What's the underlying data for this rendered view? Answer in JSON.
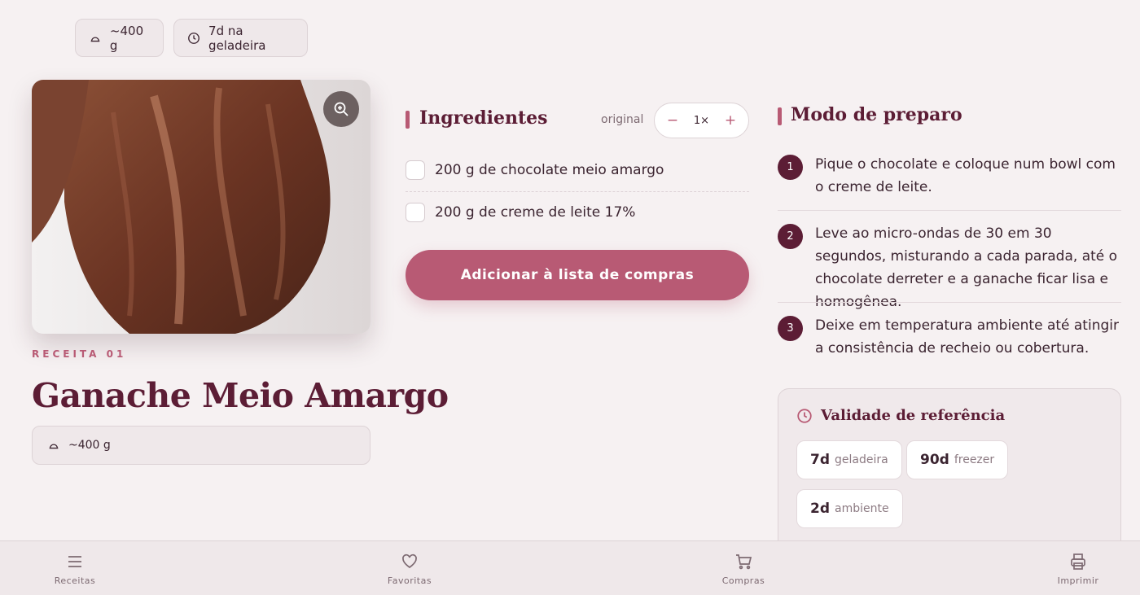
{
  "top_chips": {
    "yield": "~400 g",
    "fridge": "7d na geladeira"
  },
  "hero": {
    "image_desc_icon": "zoom-in-icon"
  },
  "recipe": {
    "kicker": "RECEITA 01",
    "title": "Ganache Meio Amargo",
    "yield": "~400 g"
  },
  "ingredients": {
    "heading": "Ingredientes",
    "original_label": "original",
    "multiplier": "1×",
    "minus": "−",
    "plus": "+",
    "items": [
      {
        "label": "200 g de chocolate meio amargo",
        "checked": false
      },
      {
        "label": "200 g de creme de leite 17%",
        "checked": false
      }
    ],
    "cta": "Adicionar à lista de compras"
  },
  "steps": {
    "heading": "Modo de preparo",
    "items": [
      {
        "n": "1",
        "text": "Pique o chocolate e coloque num bowl com o creme de leite."
      },
      {
        "n": "2",
        "text": "Leve ao micro-ondas de 30 em 30 segundos, misturando a cada parada, até o chocolate derreter e a ganache ficar lisa e homogênea."
      },
      {
        "n": "3",
        "text": "Deixe em temperatura ambiente até atingir a consistência de recheio ou cobertura."
      }
    ]
  },
  "validity": {
    "heading": "Validade de referência",
    "items": [
      {
        "value": "7d",
        "label": "geladeira"
      },
      {
        "value": "90d",
        "label": "freezer"
      },
      {
        "value": "2d",
        "label": "ambiente"
      }
    ]
  },
  "nav": {
    "items": [
      {
        "label": "Receitas",
        "icon": "menu-icon"
      },
      {
        "label": "Favoritas",
        "icon": "heart-icon"
      },
      {
        "label": "Compras",
        "icon": "cart-icon"
      },
      {
        "label": "Imprimir",
        "icon": "printer-icon"
      }
    ]
  },
  "colors": {
    "accent": "#b85a74",
    "title": "#5c1d35",
    "background": "#f6f1f2"
  }
}
